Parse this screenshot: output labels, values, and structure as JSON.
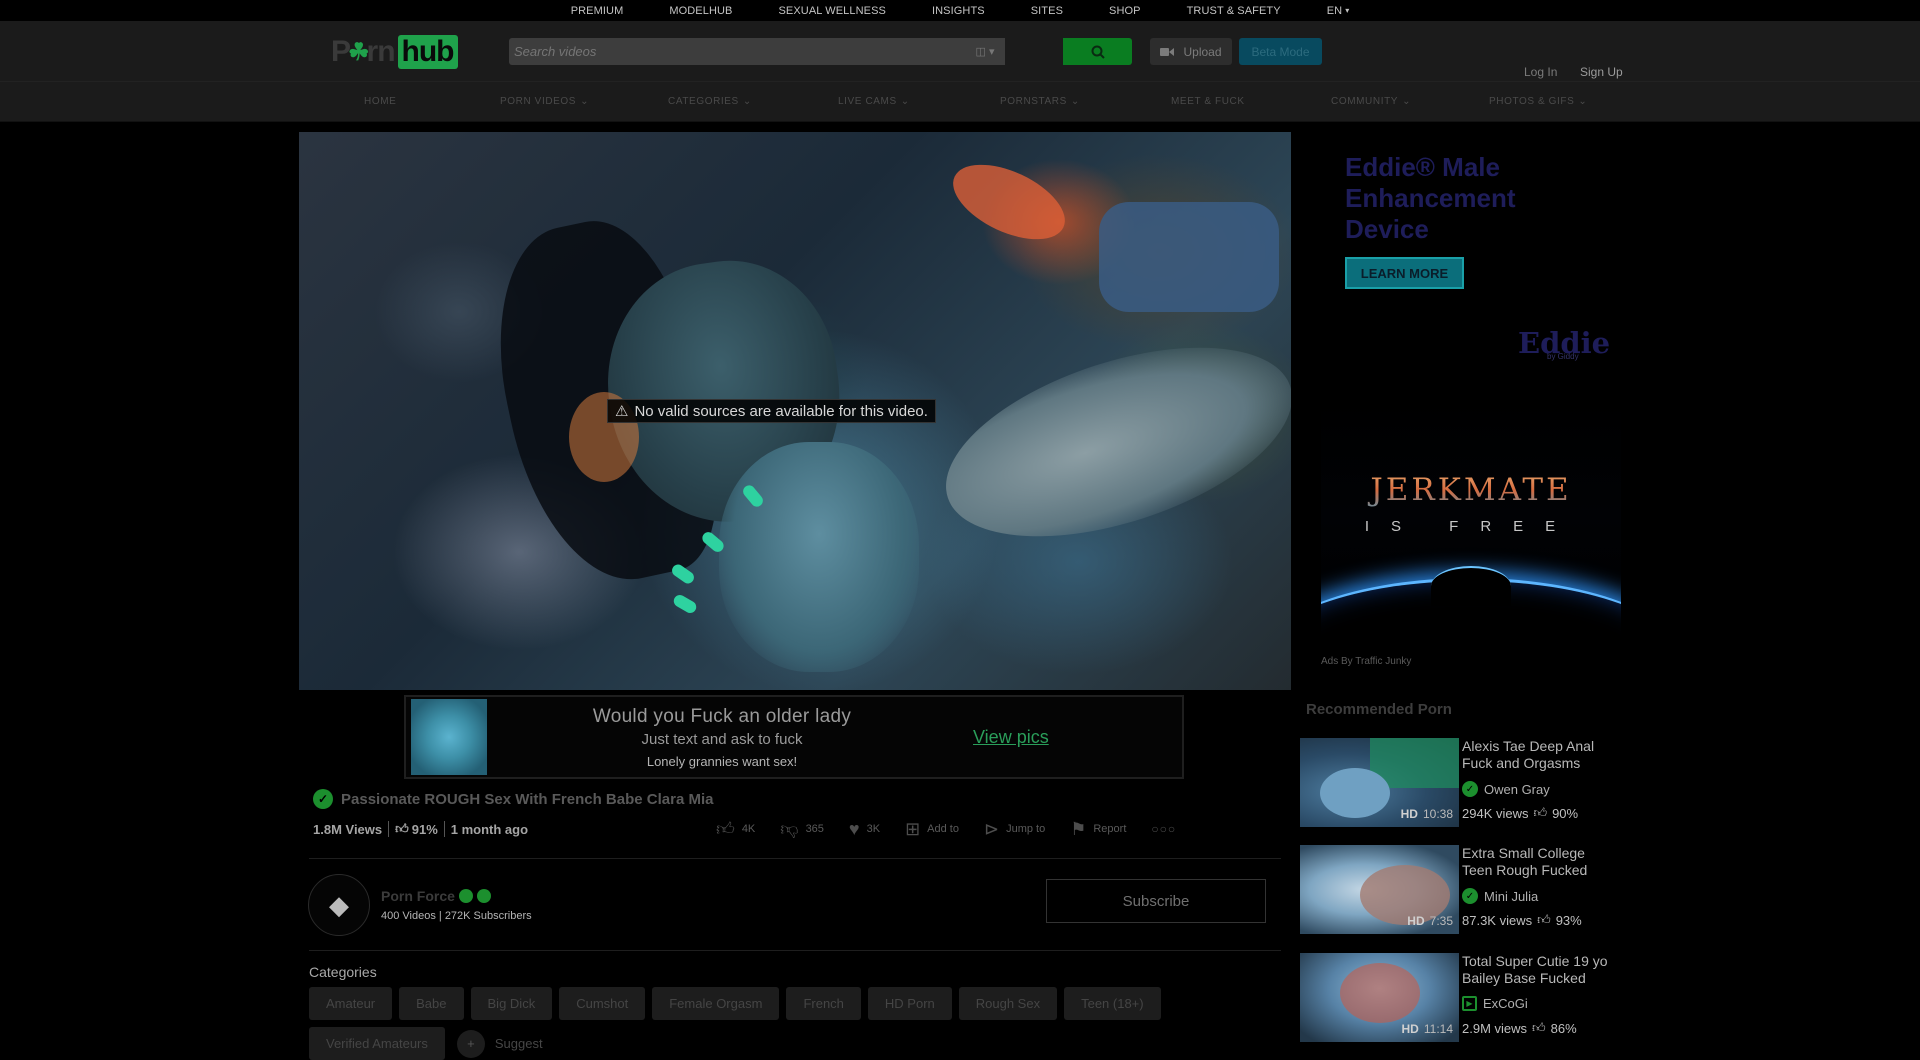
{
  "topbar": {
    "links": [
      "PREMIUM",
      "MODELHUB",
      "SEXUAL WELLNESS",
      "INSIGHTS",
      "SITES",
      "SHOP",
      "TRUST & SAFETY"
    ],
    "lang": "EN"
  },
  "header": {
    "logo_left": "P",
    "logo_mid": "rn",
    "logo_right": "hub",
    "search_placeholder": "Search videos",
    "upload_label": "Upload",
    "beta_label": "Beta Mode",
    "login": "Log In",
    "signup": "Sign Up"
  },
  "nav": {
    "items": [
      "HOME",
      "PORN VIDEOS",
      "CATEGORIES",
      "LIVE CAMS",
      "PORNSTARS",
      "MEET & FUCK",
      "COMMUNITY",
      "PHOTOS & GIFS"
    ]
  },
  "video": {
    "error": "No valid sources are available for this video."
  },
  "banner_ad": {
    "line1": "Would you Fuck an older lady",
    "line2": "Just text and ask to fuck",
    "line3": "Lonely grannies want sex!",
    "cta": "View pics"
  },
  "video_info": {
    "title": "Passionate ROUGH Sex With French Babe Clara Mia",
    "views": "1.8M Views",
    "rating": "91%",
    "age": "1 month ago",
    "likes": "4K",
    "dislikes": "365",
    "favorites": "3K",
    "add_to": "Add to",
    "jump_to": "Jump to",
    "report": "Report"
  },
  "channel": {
    "name": "Porn Force",
    "meta": "400 Videos | 272K Subscribers",
    "subscribe": "Subscribe"
  },
  "categories": {
    "title": "Categories",
    "tags": [
      "Amateur",
      "Babe",
      "Big Dick",
      "Cumshot",
      "Female Orgasm",
      "French",
      "HD Porn",
      "Rough Sex",
      "Teen (18+)",
      "Verified Amateurs"
    ],
    "suggest": "Suggest"
  },
  "ads": {
    "eddie_headline_1": "Eddie",
    "eddie_headline_2": "® Male",
    "eddie_headline_3": "Enhancement",
    "eddie_headline_4": "Device",
    "eddie_learn": "LEARN MORE",
    "eddie_brand": "Eddie",
    "eddie_by": "by Giddy",
    "jerkmate": "JERKMATE",
    "jerkmate_free": "IS FREE",
    "ads_by": "Ads By Traffic Junky"
  },
  "recommended": {
    "title": "Recommended Porn",
    "items": [
      {
        "title": "Alexis Tae Deep Anal Fuck and Orgasms",
        "author": "Owen Gray",
        "views": "294K views",
        "rating": "90%",
        "quality": "HD",
        "duration": "10:38"
      },
      {
        "title": "Extra Small College Teen Rough Fucked",
        "author": "Mini Julia",
        "views": "87.3K views",
        "rating": "93%",
        "quality": "HD",
        "duration": "7:35"
      },
      {
        "title": "Total Super Cutie 19 yo Bailey Base Fucked",
        "author": "ExCoGi",
        "views": "2.9M views",
        "rating": "86%",
        "quality": "HD",
        "duration": "11:14"
      }
    ]
  },
  "colors": {
    "brand_green": "#1fa24b",
    "background": "#000000",
    "header_bg": "#1b1b1b"
  }
}
